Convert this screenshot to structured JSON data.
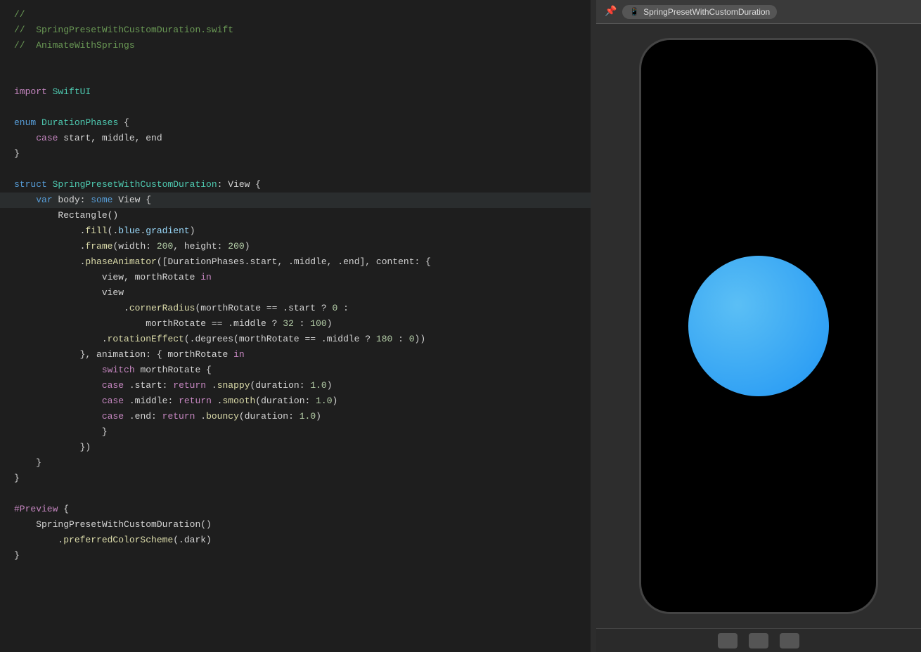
{
  "editor": {
    "lines": [
      {
        "id": 1,
        "tokens": [
          {
            "text": "//",
            "class": "c-comment"
          }
        ]
      },
      {
        "id": 2,
        "tokens": [
          {
            "text": "//  SpringPresetWithCustomDuration.swift",
            "class": "c-comment"
          }
        ]
      },
      {
        "id": 3,
        "tokens": [
          {
            "text": "//  AnimateWithSprings",
            "class": "c-comment"
          }
        ]
      },
      {
        "id": 4,
        "tokens": []
      },
      {
        "id": 5,
        "tokens": []
      },
      {
        "id": 6,
        "tokens": [
          {
            "text": "import",
            "class": "c-import"
          },
          {
            "text": " ",
            "class": "c-plain"
          },
          {
            "text": "SwiftUI",
            "class": "c-type"
          }
        ]
      },
      {
        "id": 7,
        "tokens": []
      },
      {
        "id": 8,
        "tokens": [
          {
            "text": "enum",
            "class": "c-keyword2"
          },
          {
            "text": " ",
            "class": "c-plain"
          },
          {
            "text": "DurationPhases",
            "class": "c-type"
          },
          {
            "text": " {",
            "class": "c-plain"
          }
        ]
      },
      {
        "id": 9,
        "tokens": [
          {
            "text": "    ",
            "class": "c-plain"
          },
          {
            "text": "case",
            "class": "c-keyword"
          },
          {
            "text": " start, middle, end",
            "class": "c-plain"
          }
        ]
      },
      {
        "id": 10,
        "tokens": [
          {
            "text": "}",
            "class": "c-plain"
          }
        ]
      },
      {
        "id": 11,
        "tokens": []
      },
      {
        "id": 12,
        "tokens": [
          {
            "text": "struct",
            "class": "c-keyword2"
          },
          {
            "text": " ",
            "class": "c-plain"
          },
          {
            "text": "SpringPresetWithCustomDuration",
            "class": "c-type"
          },
          {
            "text": ": View {",
            "class": "c-plain"
          }
        ]
      },
      {
        "id": 13,
        "highlighted": true,
        "tokens": [
          {
            "text": "    ",
            "class": "c-plain"
          },
          {
            "text": "var",
            "class": "c-var"
          },
          {
            "text": " body: ",
            "class": "c-plain"
          },
          {
            "text": "some",
            "class": "c-some"
          },
          {
            "text": " View {",
            "class": "c-plain"
          }
        ]
      },
      {
        "id": 14,
        "tokens": [
          {
            "text": "        Rectangle()",
            "class": "c-plain"
          }
        ]
      },
      {
        "id": 15,
        "tokens": [
          {
            "text": "            .",
            "class": "c-plain"
          },
          {
            "text": "fill",
            "class": "c-function"
          },
          {
            "text": "(.",
            "class": "c-plain"
          },
          {
            "text": "blue",
            "class": "c-property"
          },
          {
            "text": ".",
            "class": "c-plain"
          },
          {
            "text": "gradient",
            "class": "c-property"
          },
          {
            "text": ")",
            "class": "c-plain"
          }
        ]
      },
      {
        "id": 16,
        "tokens": [
          {
            "text": "            .",
            "class": "c-plain"
          },
          {
            "text": "frame",
            "class": "c-function"
          },
          {
            "text": "(width: ",
            "class": "c-plain"
          },
          {
            "text": "200",
            "class": "c-number"
          },
          {
            "text": ", height: ",
            "class": "c-plain"
          },
          {
            "text": "200",
            "class": "c-number"
          },
          {
            "text": ")",
            "class": "c-plain"
          }
        ]
      },
      {
        "id": 17,
        "tokens": [
          {
            "text": "            .",
            "class": "c-plain"
          },
          {
            "text": "phaseAnimator",
            "class": "c-function"
          },
          {
            "text": "([DurationPhases.start, .middle, .end], content: {",
            "class": "c-plain"
          }
        ]
      },
      {
        "id": 18,
        "tokens": [
          {
            "text": "                view, morthRotate ",
            "class": "c-plain"
          },
          {
            "text": "in",
            "class": "c-keyword"
          }
        ]
      },
      {
        "id": 19,
        "tokens": [
          {
            "text": "                view",
            "class": "c-plain"
          }
        ]
      },
      {
        "id": 20,
        "tokens": [
          {
            "text": "                    .",
            "class": "c-plain"
          },
          {
            "text": "cornerRadius",
            "class": "c-function"
          },
          {
            "text": "(morthRotate == .start ? ",
            "class": "c-plain"
          },
          {
            "text": "0",
            "class": "c-number"
          },
          {
            "text": " :",
            "class": "c-plain"
          }
        ]
      },
      {
        "id": 21,
        "tokens": [
          {
            "text": "                        morthRotate == .middle ? ",
            "class": "c-plain"
          },
          {
            "text": "32",
            "class": "c-number"
          },
          {
            "text": " : ",
            "class": "c-plain"
          },
          {
            "text": "100",
            "class": "c-number"
          },
          {
            "text": ")",
            "class": "c-plain"
          }
        ]
      },
      {
        "id": 22,
        "tokens": [
          {
            "text": "                .",
            "class": "c-plain"
          },
          {
            "text": "rotationEffect",
            "class": "c-function"
          },
          {
            "text": "(.degrees(morthRotate == .middle ? ",
            "class": "c-plain"
          },
          {
            "text": "180",
            "class": "c-number"
          },
          {
            "text": " : ",
            "class": "c-plain"
          },
          {
            "text": "0",
            "class": "c-number"
          },
          {
            "text": "))",
            "class": "c-plain"
          }
        ]
      },
      {
        "id": 23,
        "tokens": [
          {
            "text": "            }, animation: { morthRotate ",
            "class": "c-plain"
          },
          {
            "text": "in",
            "class": "c-keyword"
          }
        ]
      },
      {
        "id": 24,
        "tokens": [
          {
            "text": "                ",
            "class": "c-plain"
          },
          {
            "text": "switch",
            "class": "c-keyword"
          },
          {
            "text": " morthRotate {",
            "class": "c-plain"
          }
        ]
      },
      {
        "id": 25,
        "tokens": [
          {
            "text": "                ",
            "class": "c-plain"
          },
          {
            "text": "case",
            "class": "c-keyword"
          },
          {
            "text": " .start: ",
            "class": "c-plain"
          },
          {
            "text": "return",
            "class": "c-keyword"
          },
          {
            "text": " .",
            "class": "c-plain"
          },
          {
            "text": "snappy",
            "class": "c-function"
          },
          {
            "text": "(duration: ",
            "class": "c-plain"
          },
          {
            "text": "1.0",
            "class": "c-number"
          },
          {
            "text": ")",
            "class": "c-plain"
          }
        ]
      },
      {
        "id": 26,
        "tokens": [
          {
            "text": "                ",
            "class": "c-plain"
          },
          {
            "text": "case",
            "class": "c-keyword"
          },
          {
            "text": " .middle: ",
            "class": "c-plain"
          },
          {
            "text": "return",
            "class": "c-keyword"
          },
          {
            "text": " .",
            "class": "c-plain"
          },
          {
            "text": "smooth",
            "class": "c-function"
          },
          {
            "text": "(duration: ",
            "class": "c-plain"
          },
          {
            "text": "1.0",
            "class": "c-number"
          },
          {
            "text": ")",
            "class": "c-plain"
          }
        ]
      },
      {
        "id": 27,
        "tokens": [
          {
            "text": "                ",
            "class": "c-plain"
          },
          {
            "text": "case",
            "class": "c-keyword"
          },
          {
            "text": " .end: ",
            "class": "c-plain"
          },
          {
            "text": "return",
            "class": "c-keyword"
          },
          {
            "text": " .",
            "class": "c-plain"
          },
          {
            "text": "bouncy",
            "class": "c-function"
          },
          {
            "text": "(duration: ",
            "class": "c-plain"
          },
          {
            "text": "1.0",
            "class": "c-number"
          },
          {
            "text": ")",
            "class": "c-plain"
          }
        ]
      },
      {
        "id": 28,
        "tokens": [
          {
            "text": "                }",
            "class": "c-plain"
          }
        ]
      },
      {
        "id": 29,
        "tokens": [
          {
            "text": "            })",
            "class": "c-plain"
          }
        ]
      },
      {
        "id": 30,
        "tokens": [
          {
            "text": "    }",
            "class": "c-plain"
          }
        ]
      },
      {
        "id": 31,
        "tokens": [
          {
            "text": "}",
            "class": "c-plain"
          }
        ]
      },
      {
        "id": 32,
        "tokens": []
      },
      {
        "id": 33,
        "tokens": [
          {
            "text": "#Preview",
            "class": "c-preview"
          },
          {
            "text": " {",
            "class": "c-plain"
          }
        ]
      },
      {
        "id": 34,
        "tokens": [
          {
            "text": "    SpringPresetWithCustomDuration()",
            "class": "c-plain"
          }
        ]
      },
      {
        "id": 35,
        "tokens": [
          {
            "text": "        .",
            "class": "c-plain"
          },
          {
            "text": "preferredColorScheme",
            "class": "c-function"
          },
          {
            "text": "(.dark)",
            "class": "c-plain"
          }
        ]
      },
      {
        "id": 36,
        "tokens": [
          {
            "text": "}",
            "class": "c-plain"
          }
        ]
      }
    ]
  },
  "preview": {
    "title": "SpringPresetWithCustomDuration",
    "pin_label": "📌",
    "device_icon": "📱"
  }
}
